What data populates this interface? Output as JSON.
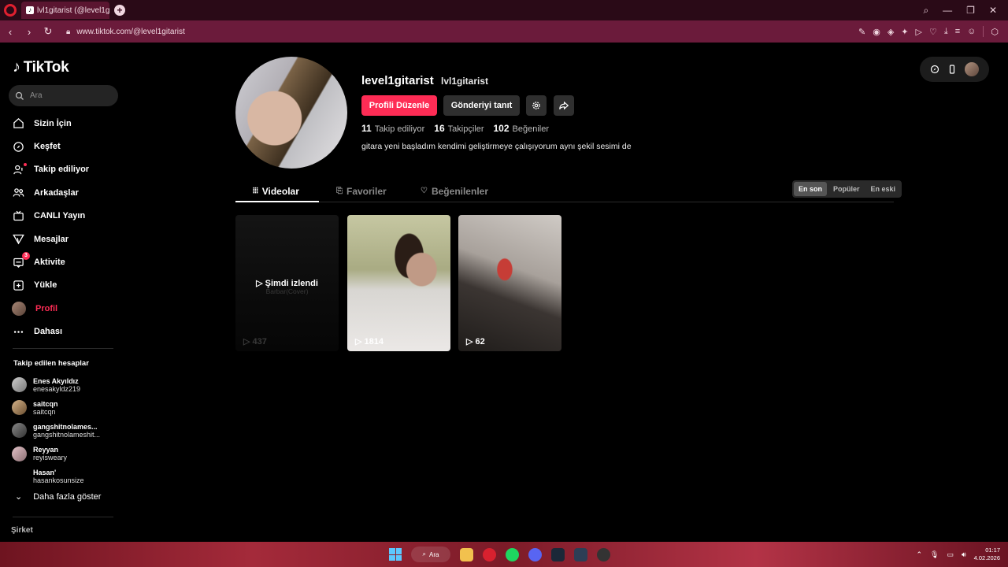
{
  "browser": {
    "tab_title": "lvl1gitarist (@level1gitari",
    "url": "www.tiktok.com/@level1gitarist"
  },
  "sidebar": {
    "logo": "TikTok",
    "search_placeholder": "Ara",
    "nav": [
      {
        "label": "Sizin İçin",
        "icon": "home-icon"
      },
      {
        "label": "Keşfet",
        "icon": "compass-icon"
      },
      {
        "label": "Takip ediliyor",
        "icon": "user-plus-icon"
      },
      {
        "label": "Arkadaşlar",
        "icon": "friends-icon"
      },
      {
        "label": "CANLI Yayın",
        "icon": "live-icon"
      },
      {
        "label": "Mesajlar",
        "icon": "send-icon"
      },
      {
        "label": "Aktivite",
        "icon": "activity-icon",
        "badge": "3"
      },
      {
        "label": "Yükle",
        "icon": "upload-icon"
      },
      {
        "label": "Profil",
        "icon": "avatar"
      },
      {
        "label": "Dahası",
        "icon": "more-icon"
      }
    ],
    "following_title": "Takip edilen hesaplar",
    "following": [
      {
        "name": "Enes Akyıldız",
        "handle": "enesakyldz219"
      },
      {
        "name": "saitcqn",
        "handle": "saitcqn"
      },
      {
        "name": "gangshitnolames...",
        "handle": "gangshitnolameshit..."
      },
      {
        "name": "Reyyan",
        "handle": "reyisweary"
      },
      {
        "name": "Hasan'",
        "handle": "hasankosunsize"
      }
    ],
    "show_more": "Daha fazla göster",
    "company": "Şirket"
  },
  "profile": {
    "username": "level1gitarist",
    "nickname": "lvl1gitarist",
    "edit_button": "Profili Düzenle",
    "promote_button": "Gönderiyi tanıt",
    "following_count": "11",
    "following_label": "Takip ediliyor",
    "followers_count": "16",
    "followers_label": "Takipçiler",
    "likes_count": "102",
    "likes_label": "Beğeniler",
    "bio": "gitara yeni başladım kendimi geliştirmeye çalışıyorum aynı şekil sesimi de"
  },
  "tabs": [
    {
      "label": "Videolar"
    },
    {
      "label": "Favoriler"
    },
    {
      "label": "Beğenilenler"
    }
  ],
  "sort": [
    "En son",
    "Popüler",
    "En eski"
  ],
  "videos": [
    {
      "views": "437",
      "watched": "Şimdi izlendi",
      "caption": "Barbar(Cover)"
    },
    {
      "views": "1814"
    },
    {
      "views": "62"
    }
  ],
  "taskbar": {
    "search": "Ara",
    "time": "01:17",
    "date": "4.02.2026"
  },
  "colors": {
    "accent": "#fe2c55",
    "browser_frame": "#6b1b3b"
  }
}
